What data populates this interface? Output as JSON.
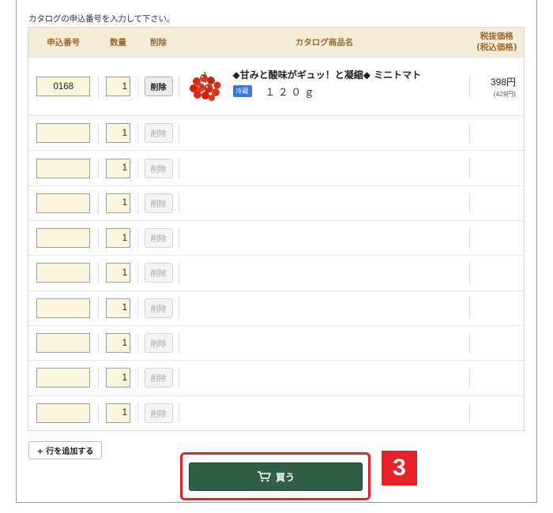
{
  "instruction": "カタログの申込番号を入力して下さい。",
  "table": {
    "headers": {
      "code": "申込番号",
      "quantity": "数量",
      "delete": "削除",
      "product": "カタログ商品名",
      "price_line1": "税抜価格",
      "price_line2": "(税込価格)"
    },
    "first_row": {
      "code": "0168",
      "quantity": "1",
      "delete_label": "削除",
      "product_name": "◆甘みと酸味がギュッ！と凝縮◆ ミニトマト",
      "badge": "冷蔵",
      "weight": "１２０ｇ",
      "price": "398円",
      "price_tax": "(429円)",
      "image_icon": "cherry-tomato-icon"
    },
    "empty_rows": [
      {
        "code": "",
        "quantity": "1",
        "delete_label": "削除"
      },
      {
        "code": "",
        "quantity": "1",
        "delete_label": "削除"
      },
      {
        "code": "",
        "quantity": "1",
        "delete_label": "削除"
      },
      {
        "code": "",
        "quantity": "1",
        "delete_label": "削除"
      },
      {
        "code": "",
        "quantity": "1",
        "delete_label": "削除"
      },
      {
        "code": "",
        "quantity": "1",
        "delete_label": "削除"
      },
      {
        "code": "",
        "quantity": "1",
        "delete_label": "削除"
      },
      {
        "code": "",
        "quantity": "1",
        "delete_label": "削除"
      },
      {
        "code": "",
        "quantity": "1",
        "delete_label": "削除"
      }
    ]
  },
  "add_row_label": "+ 行を追加する",
  "buy_button": {
    "label": "買う",
    "icon": "cart-icon"
  },
  "step_badge": "3",
  "colors": {
    "header_bg": "#f5ecd9",
    "header_text": "#9a6a2e",
    "input_bg": "#faf6dd",
    "buy_button": "#2f5f46",
    "highlight": "#e8202a",
    "badge_blue": "#3b78d8"
  }
}
